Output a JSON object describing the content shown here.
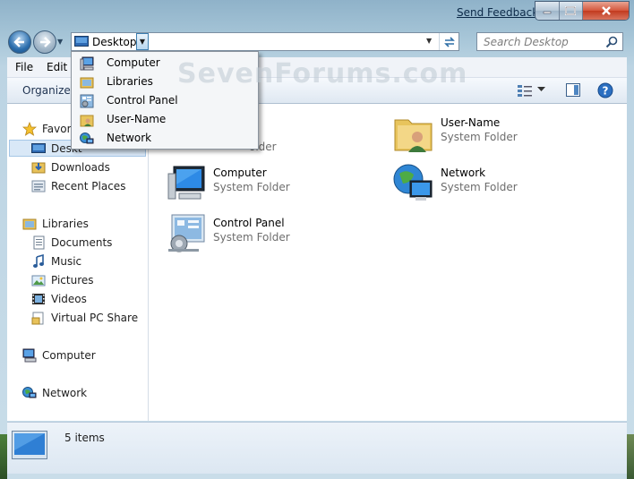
{
  "titlebar": {
    "feedback_link": "Send Feedback",
    "min_icon": "minimize-icon",
    "max_icon": "maximize-icon",
    "close_icon": "close-icon"
  },
  "navigation": {
    "address_location": "Desktop",
    "search_placeholder": "Search Desktop"
  },
  "menubar": {
    "items": [
      "File",
      "Edit"
    ]
  },
  "toolbar": {
    "organize": "Organize"
  },
  "address_dropdown": {
    "items": [
      {
        "label": "Computer",
        "icon": "computer-icon"
      },
      {
        "label": "Libraries",
        "icon": "libraries-icon"
      },
      {
        "label": "Control Panel",
        "icon": "control-panel-icon"
      },
      {
        "label": "User-Name",
        "icon": "user-folder-icon"
      },
      {
        "label": "Network",
        "icon": "network-icon"
      }
    ]
  },
  "watermark": "SevenForums.com",
  "sidebar": {
    "favorites_label": "Favori",
    "favorites": [
      {
        "label": "Deskt",
        "icon": "desktop-icon"
      },
      {
        "label": "Downloads",
        "icon": "downloads-icon"
      },
      {
        "label": "Recent Places",
        "icon": "recent-places-icon"
      }
    ],
    "libraries_label": "Libraries",
    "libraries": [
      {
        "label": "Documents",
        "icon": "documents-icon"
      },
      {
        "label": "Music",
        "icon": "music-icon"
      },
      {
        "label": "Pictures",
        "icon": "pictures-icon"
      },
      {
        "label": "Videos",
        "icon": "videos-icon"
      },
      {
        "label": "Virtual PC Share",
        "icon": "shared-folder-icon"
      }
    ],
    "computer_label": "Computer",
    "network_label": "Network"
  },
  "content": {
    "items": [
      {
        "name": "",
        "type": "older",
        "icon": "libraries-icon"
      },
      {
        "name": "User-Name",
        "type": "System Folder",
        "icon": "user-folder-icon"
      },
      {
        "name": "Computer",
        "type": "System Folder",
        "icon": "computer-icon"
      },
      {
        "name": "Network",
        "type": "System Folder",
        "icon": "network-icon"
      },
      {
        "name": "Control Panel",
        "type": "System Folder",
        "icon": "control-panel-icon"
      }
    ]
  },
  "statusbar": {
    "count": "5 items"
  },
  "colors": {
    "selection": "#d9e8f7",
    "link": "#0b2948"
  }
}
